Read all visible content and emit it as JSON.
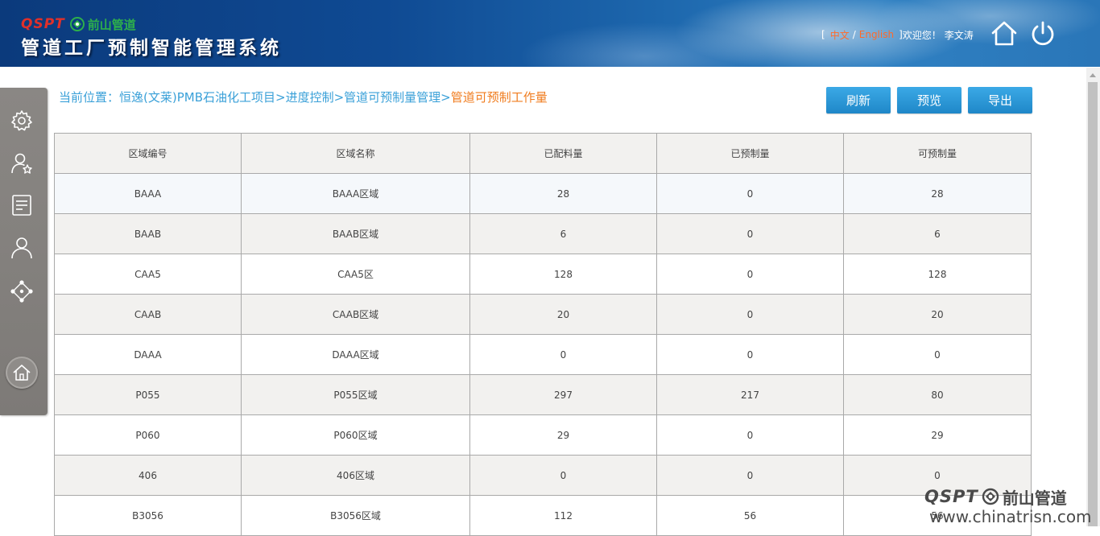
{
  "header": {
    "logo_text": "QSPT",
    "logo_cn": "前山管道",
    "system_title": "管道工厂预制智能管理系统",
    "lang_open": "[",
    "lang_zh": "中文",
    "lang_sep": "/",
    "lang_en": "English",
    "lang_close": "]",
    "welcome": "欢迎您！",
    "user_name": "李文涛"
  },
  "breadcrumb": {
    "prefix": "当前位置：",
    "path": "恒逸(文莱)PMB石油化工项目>进度控制>管道可预制量管理>",
    "current": "管道可预制工作量"
  },
  "toolbar": {
    "refresh_label": "刷新",
    "preview_label": "预览",
    "export_label": "导出"
  },
  "sidebar": {
    "items": [
      "settings-icon",
      "user-star-icon",
      "document-icon",
      "user-icon",
      "network-icon",
      "home-icon"
    ]
  },
  "table": {
    "headers": [
      "区域编号",
      "区域名称",
      "已配料量",
      "已预制量",
      "可预制量"
    ],
    "rows": [
      [
        "BAAA",
        "BAAA区域",
        "28",
        "0",
        "28"
      ],
      [
        "BAAB",
        "BAAB区域",
        "6",
        "0",
        "6"
      ],
      [
        "CAA5",
        "CAA5区",
        "128",
        "0",
        "128"
      ],
      [
        "CAAB",
        "CAAB区域",
        "20",
        "0",
        "20"
      ],
      [
        "DAAA",
        "DAAA区域",
        "0",
        "0",
        "0"
      ],
      [
        "P055",
        "P055区域",
        "297",
        "217",
        "80"
      ],
      [
        "P060",
        "P060区域",
        "29",
        "0",
        "29"
      ],
      [
        "406",
        "406区域",
        "0",
        "0",
        "0"
      ],
      [
        "B3056",
        "B3056区域",
        "112",
        "56",
        "56"
      ]
    ]
  },
  "watermark": {
    "brand": "QSPT",
    "brand_cn": "前山管道",
    "url": "www.chinatrisn.com"
  },
  "colors": {
    "breadcrumb": "#3aa0d8",
    "breadcrumb_current": "#f07c1e",
    "button": "#2a97d8",
    "lang_link": "#ff6a2a",
    "logo_red": "#e0302a",
    "logo_green": "#2db04b"
  }
}
